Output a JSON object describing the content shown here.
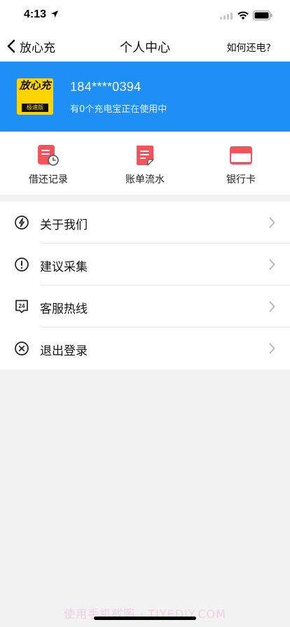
{
  "status_bar": {
    "time": "4:13",
    "icons": [
      "location-arrow-icon",
      "signal-icon",
      "wifi-icon",
      "battery-icon"
    ]
  },
  "nav": {
    "back_label": "放心充",
    "title": "个人中心",
    "right_link": "如何还电?"
  },
  "profile": {
    "logo_text": "放心充",
    "logo_sub": "极速版",
    "phone": "184****0394",
    "status": "有0个充电宝正在使用中",
    "colors": {
      "banner": "#1e90f5",
      "logo_bg": "#ffd400"
    }
  },
  "quick_actions": [
    {
      "label": "借还记录",
      "icon": "borrow-record-icon"
    },
    {
      "label": "账单流水",
      "icon": "bill-icon"
    },
    {
      "label": "银行卡",
      "icon": "bank-card-icon"
    }
  ],
  "menu": [
    {
      "label": "关于我们",
      "icon": "about-icon"
    },
    {
      "label": "建议采集",
      "icon": "suggestion-icon"
    },
    {
      "label": "客服热线",
      "icon": "hotline-24-icon",
      "icon_text": "24"
    },
    {
      "label": "退出登录",
      "icon": "logout-icon"
    }
  ],
  "watermark": "使用手机截图 · TIYEDIY.COM",
  "accent_color": "#f2545b"
}
